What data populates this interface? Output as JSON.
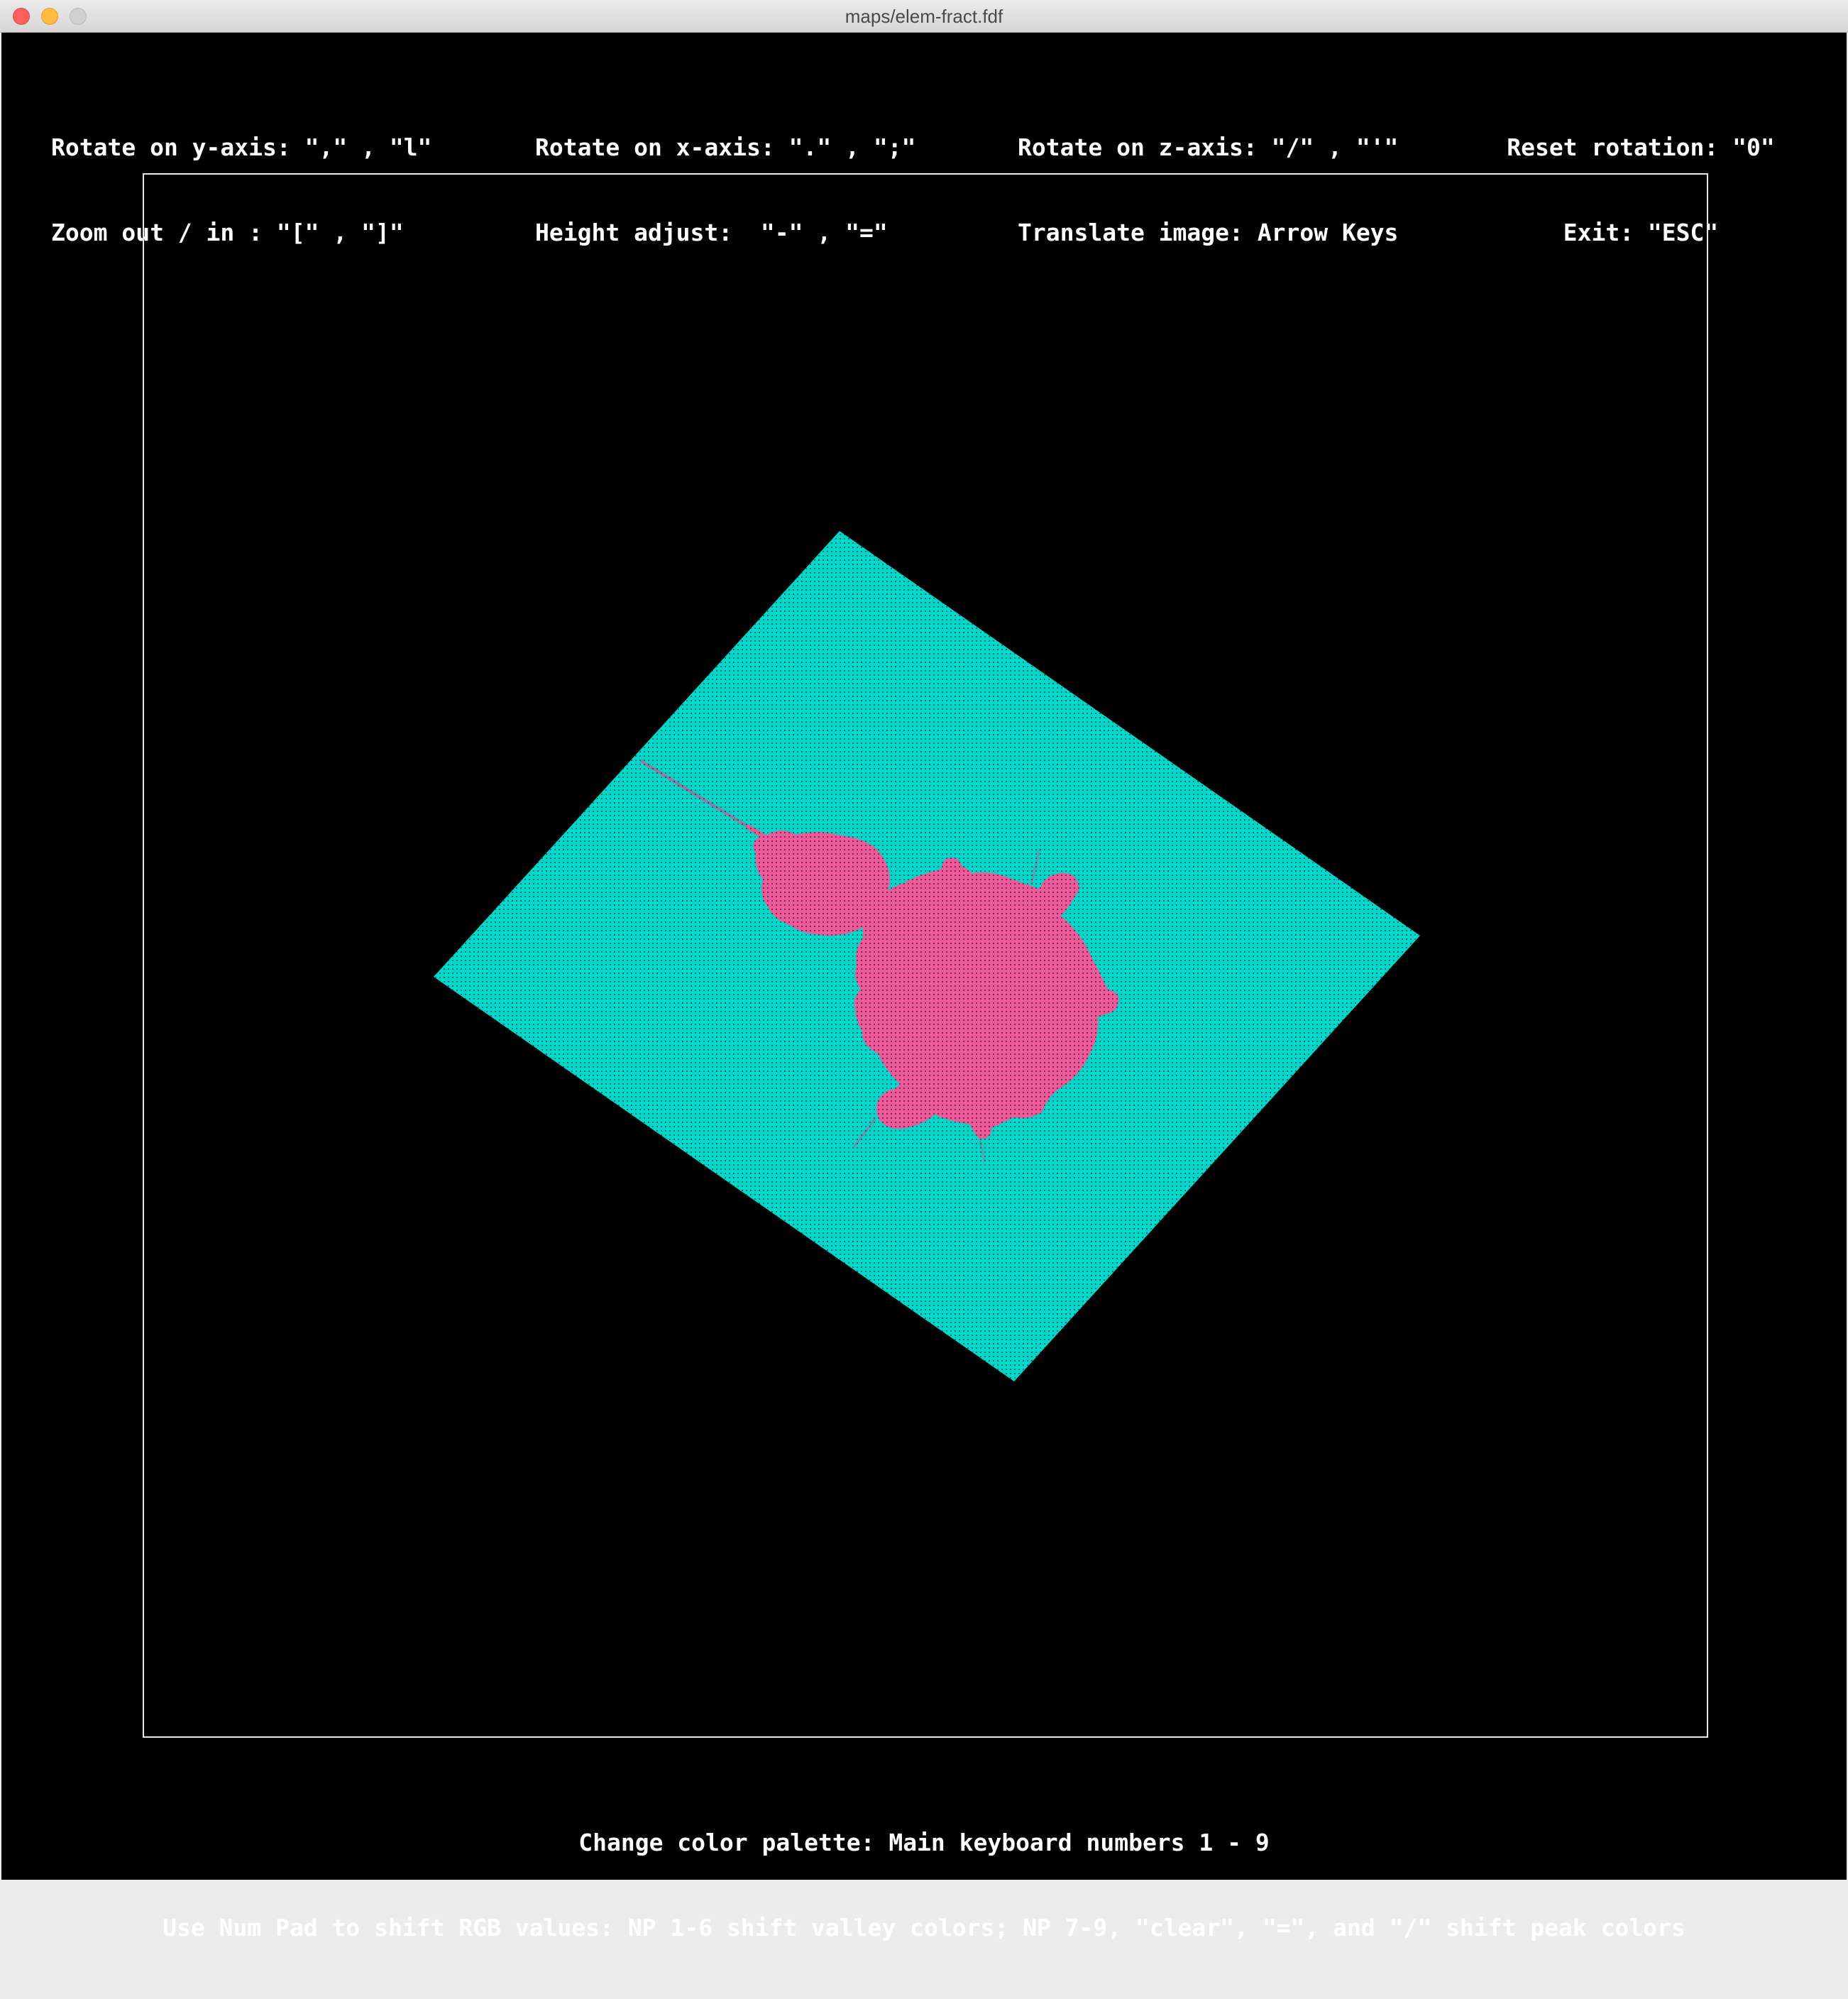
{
  "window": {
    "title": "maps/elem-fract.fdf"
  },
  "help_top": {
    "col1": {
      "line1": "Rotate on y-axis: \",\" , \"l\"",
      "line2": "Zoom out / in : \"[\" , \"]\""
    },
    "col2": {
      "line1": "Rotate on x-axis: \".\" , \";\"",
      "line2": "Height adjust:  \"-\" , \"=\""
    },
    "col3": {
      "line1": "Rotate on z-axis: \"/\" , \"'\"",
      "line2": "Translate image: Arrow Keys"
    },
    "col4": {
      "line1": "Reset rotation: \"0\"",
      "line2": "Exit: \"ESC\""
    }
  },
  "help_bottom": {
    "line1": "Change color palette: Main keyboard numbers 1 - 9",
    "line2": "Use Num Pad to shift RGB values: NP 1-6 shift valley colors; NP 7-9, \"clear\", \"=\", and \"/\" shift peak colors"
  },
  "colors": {
    "background": "#000000",
    "valley": "#00d8cc",
    "peak": "#ee5a9a",
    "frame": "#e8e8e8"
  },
  "icons": [
    "close-icon",
    "minimize-icon",
    "zoom-icon"
  ]
}
